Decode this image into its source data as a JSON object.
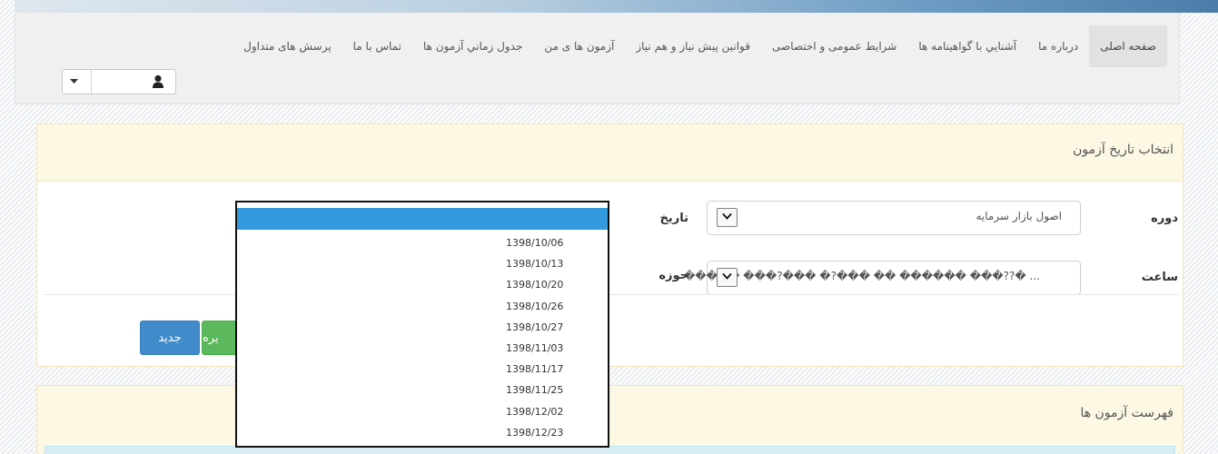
{
  "nav": {
    "items": [
      {
        "label": "صفحه اصلی",
        "active": true
      },
      {
        "label": "درباره ما"
      },
      {
        "label": "آشنايي با گواهينامه ها"
      },
      {
        "label": "شرايط عمومی و اختصاصی"
      },
      {
        "label": "قوانين پيش نياز و هم نياز"
      },
      {
        "label": "آزمون ها ی من"
      },
      {
        "label": "جدول زماني آزمون ها"
      },
      {
        "label": "تماس با ما"
      },
      {
        "label": "پرسش های متداول"
      }
    ]
  },
  "user_menu": {
    "icon": "user-icon",
    "caret_icon": "caret-down-icon"
  },
  "exam_date_panel": {
    "title": "انتخاب تاريخ آزمون",
    "course_label": "دوره",
    "course_value": "اصول بازار سرمايه",
    "date_label": "تاريخ",
    "time_label": "ساعت",
    "time_value": "�����  ���?���  �?���  ��  ������  ���??� ...",
    "area_label": "حوزه",
    "save_button_partial": "يره",
    "new_button": "جديد"
  },
  "exam_list_panel": {
    "title": "فهرست آزمون ها"
  },
  "date_dropdown": {
    "selected": "",
    "options": [
      "1398/10/06",
      "1398/10/13",
      "1398/10/20",
      "1398/10/26",
      "1398/10/27",
      "1398/11/03",
      "1398/11/17",
      "1398/11/25",
      "1398/12/02",
      "1398/12/23"
    ]
  },
  "colors": {
    "nav_bg": "#f0f0f0",
    "panel_heading_bg": "#fcf8e4",
    "primary_button": "#428bca",
    "success_button": "#5cb85c",
    "dropdown_highlight": "#3399dd"
  }
}
